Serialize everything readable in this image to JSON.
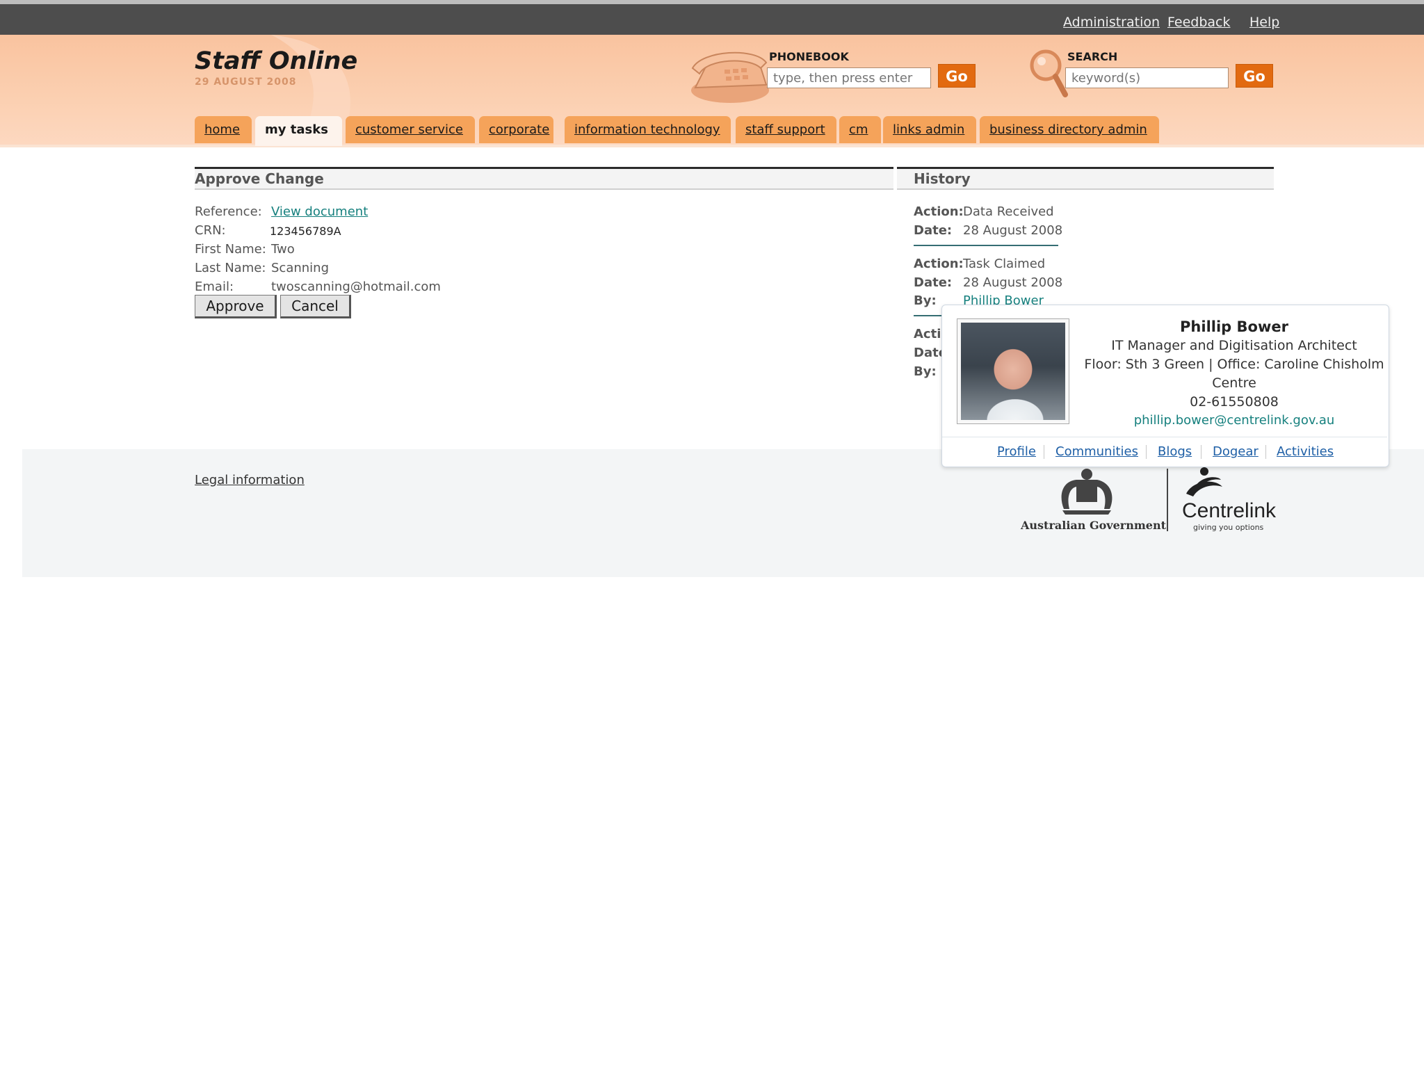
{
  "util_links": [
    "Administration",
    "Feedback",
    "Help"
  ],
  "site": {
    "title": "Staff Online",
    "date": "29 AUGUST 2008"
  },
  "phonebook": {
    "label": "PHONEBOOK",
    "placeholder": "type, then press enter",
    "go": "Go"
  },
  "search": {
    "label": "SEARCH",
    "placeholder": "keyword(s)",
    "go": "Go"
  },
  "tabs": [
    {
      "label": "home",
      "active": false
    },
    {
      "label": "my tasks",
      "active": true
    },
    {
      "label": "customer service",
      "active": false
    },
    {
      "label": "corporate",
      "active": false
    },
    {
      "label": "information technology",
      "active": false
    },
    {
      "label": "staff support",
      "active": false
    },
    {
      "label": "cm",
      "active": false
    },
    {
      "label": "links admin",
      "active": false
    },
    {
      "label": "business directory admin",
      "active": false
    }
  ],
  "approve": {
    "heading": "Approve Change",
    "fields": [
      {
        "label": "Reference:",
        "value": "View document",
        "is_link": true
      },
      {
        "label": "CRN:",
        "value": "123456789A"
      },
      {
        "label": "First Name:",
        "value": "Two"
      },
      {
        "label": "Last Name:",
        "value": "Scanning"
      },
      {
        "label": "Email:",
        "value": "twoscanning@hotmail.com"
      }
    ],
    "approve_button": "Approve",
    "cancel_button": "Cancel"
  },
  "history": {
    "heading": "History",
    "entries": [
      {
        "action_label": "Action:",
        "action": "Data Received",
        "date_label": "Date:",
        "date": "28 August 2008"
      },
      {
        "action_label": "Action:",
        "action": "Task Claimed",
        "date_label": "Date:",
        "date": "28 August 2008",
        "by_label": "By:",
        "by": "Phillip Bower"
      },
      {
        "action_label": "Acti",
        "date_label": "Date",
        "by_label": "By:"
      }
    ]
  },
  "footer": {
    "legal": "Legal information",
    "gov_text": "Australian Government",
    "centrelink_name": "Centrelink",
    "centrelink_tagline": "giving you options"
  },
  "card": {
    "name": "Phillip Bower",
    "title": "IT Manager and Digitisation Architect",
    "location_line1": "Floor: Sth 3 Green | Office: Caroline Chisholm",
    "location_line2": "Centre",
    "phone": "02-61550808",
    "email": "phillip.bower@centrelink.gov.au",
    "links": [
      "Profile",
      "Communities",
      "Blogs",
      "Dogear",
      "Activities"
    ]
  },
  "colors": {
    "header_orange": "#f9c39f",
    "tab_orange": "#f5a35a",
    "go_button": "#e26a10",
    "link_teal": "#16807e"
  }
}
